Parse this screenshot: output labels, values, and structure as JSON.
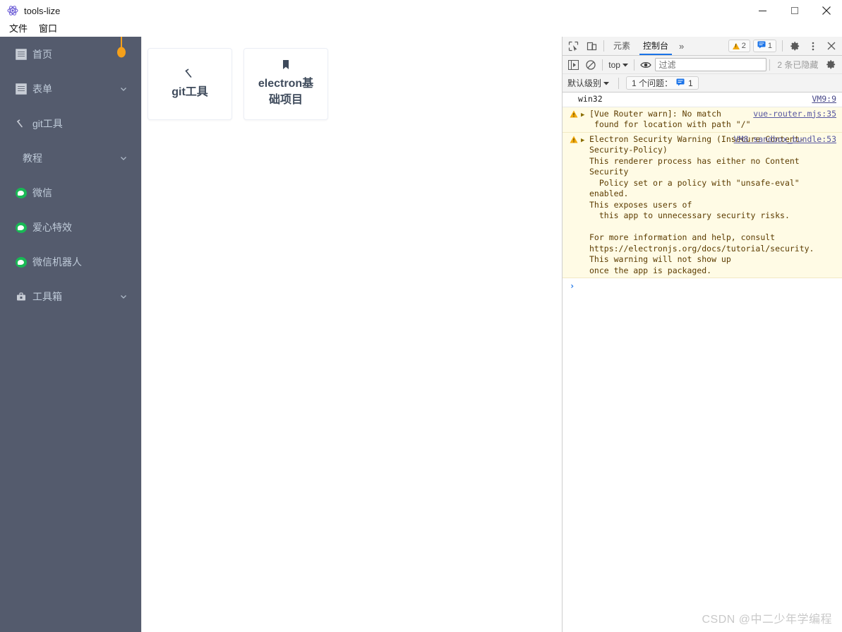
{
  "window": {
    "title": "tools-lize",
    "app_icon": "electron-icon",
    "controls": {
      "minimize": "—",
      "maximize": "☐",
      "close": "✕"
    }
  },
  "menubar": {
    "items": [
      {
        "label": "文件"
      },
      {
        "label": "窗口"
      }
    ]
  },
  "sidebar": {
    "background": "#545b6d",
    "items": [
      {
        "label": "首页",
        "icon": "document-icon",
        "chevron": false,
        "sub": false
      },
      {
        "label": "表单",
        "icon": "document-icon",
        "chevron": true,
        "sub": false
      },
      {
        "label": "git工具",
        "icon": "wrench-icon",
        "chevron": false,
        "sub": false
      },
      {
        "label": "教程",
        "icon": "none",
        "chevron": true,
        "sub": true
      },
      {
        "label": "微信",
        "icon": "wechat-icon",
        "chevron": false,
        "sub": false
      },
      {
        "label": "爱心特效",
        "icon": "wechat-icon",
        "chevron": false,
        "sub": false
      },
      {
        "label": "微信机器人",
        "icon": "wechat-icon",
        "chevron": false,
        "sub": false
      },
      {
        "label": "工具箱",
        "icon": "toolbox-icon",
        "chevron": true,
        "sub": false
      }
    ],
    "pin_color": "#f5a01a"
  },
  "content": {
    "cards": [
      {
        "label": "git工具",
        "icon": "wrench-icon"
      },
      {
        "label": "electron基础项目",
        "icon": "bookmark-icon"
      }
    ]
  },
  "devtools": {
    "toolbar": {
      "inspect_icon": "inspect-element-icon",
      "device_icon": "device-toolbar-icon",
      "tabs": [
        {
          "label": "元素",
          "active": false
        },
        {
          "label": "控制台",
          "active": true
        }
      ],
      "more_tabs": "»",
      "warning_badge": "2",
      "message_badge": "1",
      "settings_icon": "gear-icon",
      "menu_icon": "kebab-menu-icon",
      "close_icon": "close-icon"
    },
    "filterbar": {
      "sidebar_toggle_icon": "console-sidebar-icon",
      "clear_icon": "clear-console-icon",
      "context": "top",
      "eye_icon": "live-expression-icon",
      "filter_placeholder": "过滤",
      "filter_value": "",
      "hidden_text": "2 条已隐藏",
      "settings_icon": "console-settings-gear-icon"
    },
    "levelbar": {
      "level": "默认级别",
      "issues_label": "1 个问题：",
      "issues_count": "1"
    },
    "messages": [
      {
        "type": "info",
        "text": "win32",
        "source": "VM9:9",
        "expandable": false
      },
      {
        "type": "warn",
        "text": "[Vue Router warn]: No match\n found for location with path \"/\"",
        "source": "vue-router.mjs:35",
        "expandable": true
      },
      {
        "type": "warn",
        "text": "Electron Security Warning (Insecure Content-Security-Policy)\nThis renderer process has either no Content Security\n  Policy set or a policy with \"unsafe-eval\" enabled.\nThis exposes users of\n  this app to unnecessary security risks.\n\nFor more information and help, consult\nhttps://electronjs.org/docs/tutorial/security.\nThis warning will not show up\nonce the app is packaged.",
        "source": "VM8 sandbox_bundle:53",
        "expandable": true,
        "link": "https://electronjs.org/docs/tutorial/security"
      }
    ],
    "prompt": {
      "chevron": "›",
      "value": ""
    }
  },
  "watermark": {
    "text": "CSDN @中二少年学编程"
  }
}
